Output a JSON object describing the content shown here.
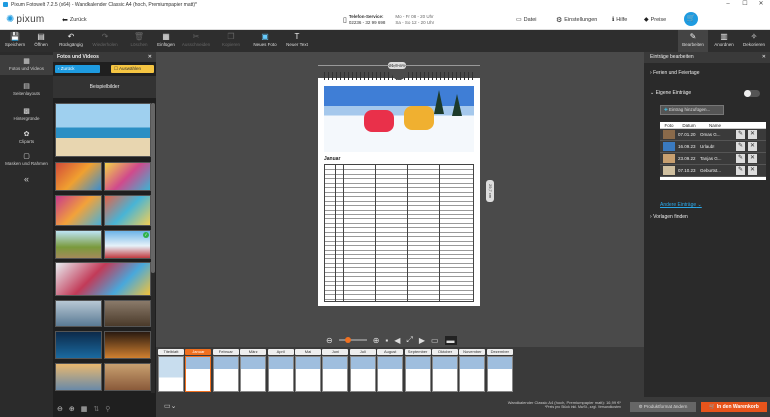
{
  "window": {
    "title": "Pixum Fotowelt 7.2.5 (x64) - Wandkalender Classic A4 (hoch, Premiumpapier matt)*",
    "minimize": "–",
    "maximize": "☐",
    "close": "✕"
  },
  "header": {
    "logo": "pixum",
    "back": "Zurück",
    "phone_label": "Telefon-Service:",
    "phone_number": "02236 - 32 99 698",
    "hours1": "Mo - Fr 08 - 20 Uhr",
    "hours2": "Sa - So 12 - 20 Uhr",
    "datei": "Datei",
    "einstellungen": "Einstellungen",
    "hilfe": "Hilfe",
    "preise": "Preise"
  },
  "toolbar": {
    "speichern": "Speichern",
    "oeffnen": "Öffnen",
    "rueckgaengig": "Rückgängig",
    "wiederholen": "Wiederholen",
    "loeschen": "Löschen",
    "einfuegen": "Einfügen",
    "ausschneiden": "Ausschneiden",
    "kopieren": "Kopieren",
    "neues_foto": "Neues Foto",
    "neuer_text": "Neuer Text",
    "bearbeiten": "Bearbeiten",
    "anordnen": "Anordnen",
    "dekorieren": "Dekorieren"
  },
  "leftnav": {
    "fotos": "Fotos und Videos",
    "seitenlayouts": "Seitenlayouts",
    "hintergruende": "Hintergründe",
    "cliparts": "Cliparts",
    "masken": "Masken und Rahmen"
  },
  "photopanel": {
    "title": "Fotos und Videos",
    "zurueck": "Zurück",
    "auswaehlen": "Auswählen",
    "tab": "Beispielbilder"
  },
  "calendar": {
    "size_label": "21,0 cm",
    "month": "Januar",
    "height_label": "29,7 cm"
  },
  "filmstrip": [
    "Titelblatt",
    "Januar",
    "Februar",
    "März",
    "April",
    "Mai",
    "Juni",
    "Juli",
    "August",
    "September",
    "Oktober",
    "November",
    "Dezember"
  ],
  "rightpanel": {
    "title": "Einträge bearbeiten",
    "ferien": "Ferien und Feiertage",
    "eigene": "Eigene Einträge",
    "add": "Eintrag hinzufügen...",
    "col_foto": "Foto",
    "col_datum": "Datum",
    "col_name": "Name",
    "entries": [
      {
        "datum": "07.01.20",
        "name": "Omas G..."
      },
      {
        "datum": "16.09.23",
        "name": "Urlaub!"
      },
      {
        "datum": "23.09.22",
        "name": "Tanjas G..."
      },
      {
        "datum": "07.10.23",
        "name": "Geburtst..."
      }
    ],
    "andere": "Andere Einträge",
    "vorlagen": "Vorlagen finden"
  },
  "bottom": {
    "status1": "Wandkalender Classic A4 (hoch, Premiumpapier matt): 16,99 €*",
    "status2": "*Preis pro Stück inkl. MwSt., zzgl. Versandkosten",
    "produkt": "Produktformat ändern",
    "warenkorb": "In den Warenkorb"
  },
  "colors": {
    "accent": "#f07020",
    "brand": "#1e9be0",
    "cart": "#e8541b"
  }
}
